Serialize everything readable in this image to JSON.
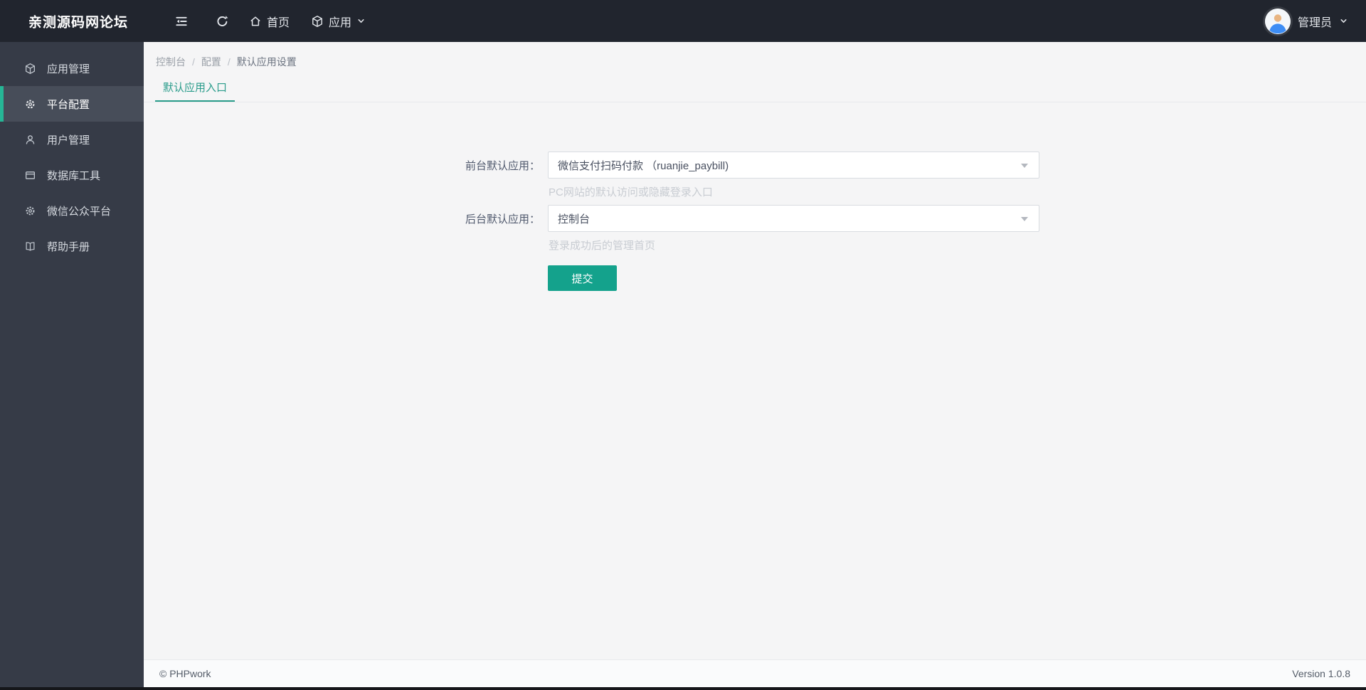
{
  "topbar": {
    "title": "亲测源码网论坛",
    "nav": {
      "home_label": "首页",
      "apps_label": "应用"
    },
    "user": {
      "name": "管理员"
    }
  },
  "sidebar": {
    "items": [
      {
        "label": "应用管理",
        "icon": "cube-icon",
        "active": false
      },
      {
        "label": "平台配置",
        "icon": "gear-icon",
        "active": true
      },
      {
        "label": "用户管理",
        "icon": "user-icon",
        "active": false
      },
      {
        "label": "数据库工具",
        "icon": "window-icon",
        "active": false
      },
      {
        "label": "微信公众平台",
        "icon": "cog-icon",
        "active": false
      },
      {
        "label": "帮助手册",
        "icon": "book-icon",
        "active": false
      }
    ]
  },
  "breadcrumb": {
    "separator": "/",
    "items": [
      "控制台",
      "配置",
      "默认应用设置"
    ]
  },
  "tabs": {
    "active_label": "默认应用入口"
  },
  "form": {
    "rows": [
      {
        "label": "前台默认应用：",
        "value": "微信支付扫码付款 （ruanjie_paybill)",
        "help": "PC网站的默认访问或隐藏登录入口"
      },
      {
        "label": "后台默认应用：",
        "value": "控制台",
        "help": "登录成功后的管理首页"
      }
    ],
    "submit_label": "提交"
  },
  "footer": {
    "copyright": "© PHPwork",
    "version": "Version 1.0.8"
  },
  "colors": {
    "accent": "#14a28c",
    "tab_accent": "#2a9c8b",
    "sidebar_active_border": "#26b696",
    "topbar_bg": "#21252e",
    "sidebar_bg": "#363b47",
    "sidebar_active_bg": "#474d59",
    "main_bg": "#f5f5f6"
  }
}
